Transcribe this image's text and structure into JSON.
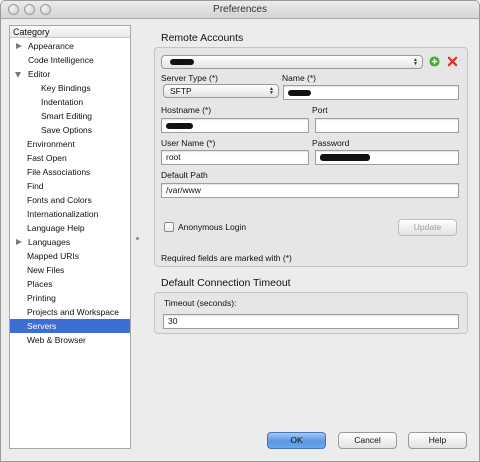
{
  "window": {
    "title": "Preferences"
  },
  "sidebar": {
    "header": "Category",
    "items": [
      {
        "label": "Appearance",
        "indent": 1,
        "arrow": "right",
        "selected": false
      },
      {
        "label": "Code Intelligence",
        "indent": 1,
        "arrow": "",
        "selected": false
      },
      {
        "label": "Editor",
        "indent": 1,
        "arrow": "down",
        "selected": false
      },
      {
        "label": "Key Bindings",
        "indent": 2,
        "arrow": "",
        "selected": false
      },
      {
        "label": "Indentation",
        "indent": 2,
        "arrow": "",
        "selected": false
      },
      {
        "label": "Smart Editing",
        "indent": 2,
        "arrow": "",
        "selected": false
      },
      {
        "label": "Save Options",
        "indent": 2,
        "arrow": "",
        "selected": false
      },
      {
        "label": "Environment",
        "indent": 0,
        "arrow": "",
        "selected": false
      },
      {
        "label": "Fast Open",
        "indent": 0,
        "arrow": "",
        "selected": false
      },
      {
        "label": "File Associations",
        "indent": 0,
        "arrow": "",
        "selected": false
      },
      {
        "label": "Find",
        "indent": 0,
        "arrow": "",
        "selected": false
      },
      {
        "label": "Fonts and Colors",
        "indent": 0,
        "arrow": "",
        "selected": false
      },
      {
        "label": "Internationalization",
        "indent": 0,
        "arrow": "",
        "selected": false
      },
      {
        "label": "Language Help",
        "indent": 0,
        "arrow": "",
        "selected": false
      },
      {
        "label": "Languages",
        "indent": 1,
        "arrow": "right",
        "selected": false
      },
      {
        "label": "Mapped URIs",
        "indent": 0,
        "arrow": "",
        "selected": false
      },
      {
        "label": "New Files",
        "indent": 0,
        "arrow": "",
        "selected": false
      },
      {
        "label": "Places",
        "indent": 0,
        "arrow": "",
        "selected": false
      },
      {
        "label": "Printing",
        "indent": 0,
        "arrow": "",
        "selected": false
      },
      {
        "label": "Projects and Workspace",
        "indent": 0,
        "arrow": "",
        "selected": false
      },
      {
        "label": "Servers",
        "indent": 0,
        "arrow": "",
        "selected": true
      },
      {
        "label": "Web & Browser",
        "indent": 0,
        "arrow": "",
        "selected": false
      }
    ]
  },
  "remote_accounts": {
    "title": "Remote Accounts",
    "add_icon": "plus-circle-icon",
    "remove_icon": "red-x-icon",
    "server_type_label": "Server Type (*)",
    "server_type_value": "SFTP",
    "name_label": "Name (*)",
    "hostname_label": "Hostname (*)",
    "port_label": "Port",
    "port_value": "",
    "username_label": "User Name (*)",
    "username_value": "root",
    "password_label": "Password",
    "default_path_label": "Default Path",
    "default_path_value": "/var/www",
    "anonymous_login_label": "Anonymous Login",
    "update_button": "Update",
    "required_note": "Required fields are marked with (*)"
  },
  "timeout": {
    "title": "Default Connection Timeout",
    "label": "Timeout (seconds):",
    "value": "30"
  },
  "buttons": {
    "ok": "OK",
    "cancel": "Cancel",
    "help": "Help"
  },
  "colors": {
    "selection": "#3d6ed3",
    "add_icon": "#3fae2a",
    "remove_icon": "#e0302a",
    "default_button": "#5a98e6"
  }
}
